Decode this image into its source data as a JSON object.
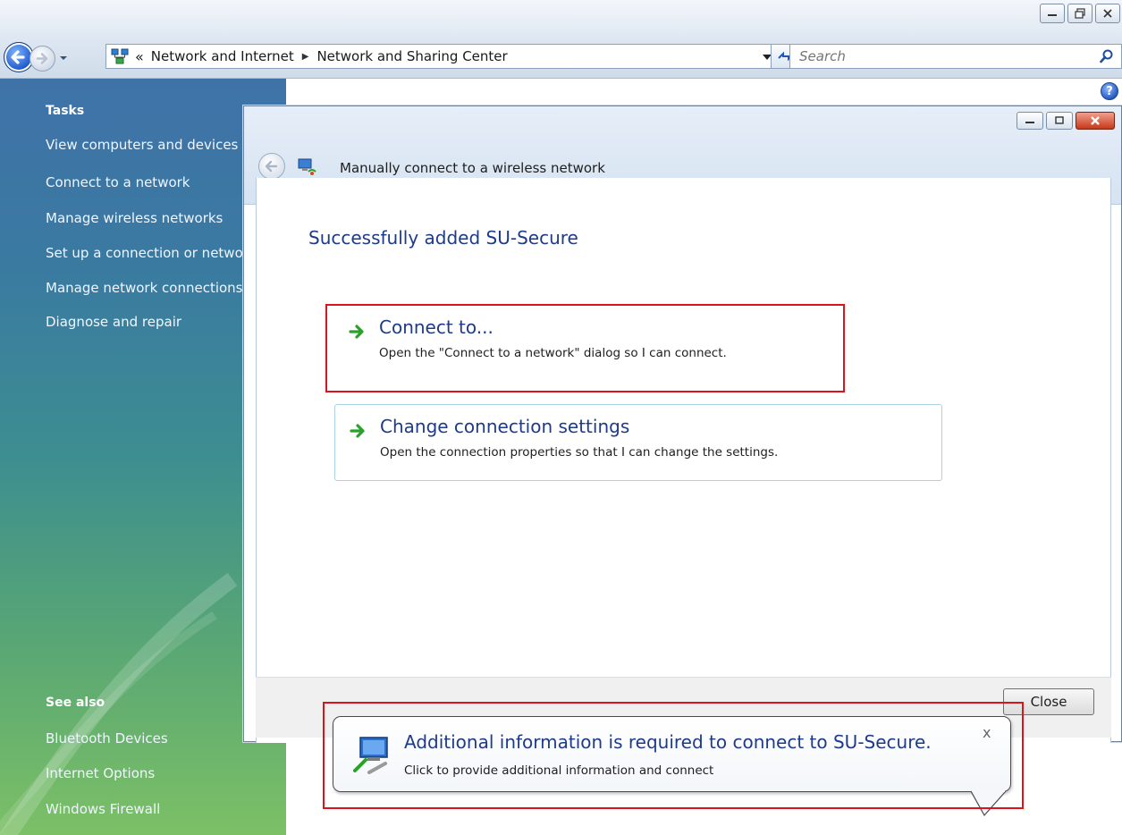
{
  "explorer": {
    "breadcrumb": [
      "Network and Internet",
      "Network and Sharing Center"
    ],
    "breadcrumb_overflow": "«",
    "search_placeholder": "Search",
    "help": "?"
  },
  "task_pane": {
    "tasks_heading": "Tasks",
    "tasks": [
      "View computers and devices",
      "Connect to a network",
      "Manage wireless networks",
      "Set up a connection or network",
      "Manage network connections",
      "Diagnose and repair"
    ],
    "see_also_heading": "See also",
    "see_also": [
      "Bluetooth Devices",
      "Internet Options",
      "Windows Firewall"
    ]
  },
  "dialog": {
    "title": "Manually connect to a wireless network",
    "heading": "Successfully added SU-Secure",
    "options": [
      {
        "title": "Connect to...",
        "description": "Open the \"Connect to a network\" dialog so I can connect."
      },
      {
        "title": "Change connection settings",
        "description": "Open the connection properties so that I can change the settings."
      }
    ],
    "close_label": "Close"
  },
  "balloon": {
    "title": "Additional information is required to connect to SU-Secure.",
    "text": "Click to provide additional information and connect",
    "close": "x"
  },
  "colors": {
    "annotation": "#d9141a",
    "link_blue": "#1e3b8a",
    "arrow_green": "#2aa12a"
  },
  "icons": {
    "back": "back-arrow-icon",
    "forward": "forward-arrow-icon",
    "network": "network-icon",
    "refresh": "refresh-icon",
    "search": "magnifier-icon",
    "wizard": "wireless-wizard-icon",
    "command_arrow": "green-arrow-icon",
    "balloon": "wireless-network-icon"
  }
}
